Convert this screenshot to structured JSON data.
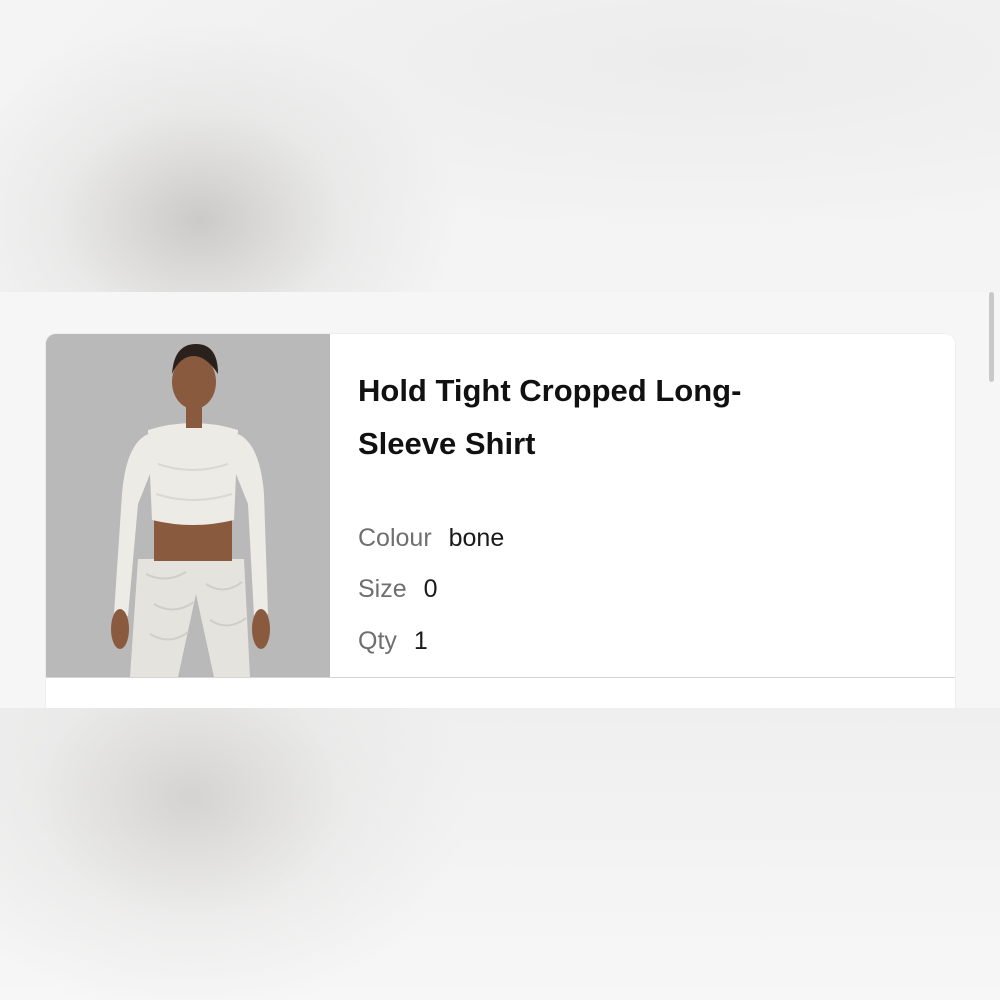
{
  "product": {
    "title": "Hold Tight Cropped Long-Sleeve Shirt",
    "image_alt": "Model wearing Hold Tight Cropped Long-Sleeve Shirt in bone",
    "attributes": {
      "colour_label": "Colour",
      "colour_value": "bone",
      "size_label": "Size",
      "size_value": "0",
      "qty_label": "Qty",
      "qty_value": "1"
    }
  },
  "colors": {
    "image_background": "#b8b8b8",
    "garment": "#ecebe6",
    "skin": "#8a5a3e",
    "label_text": "#6f6f6f",
    "value_text": "#1a1a1a"
  }
}
